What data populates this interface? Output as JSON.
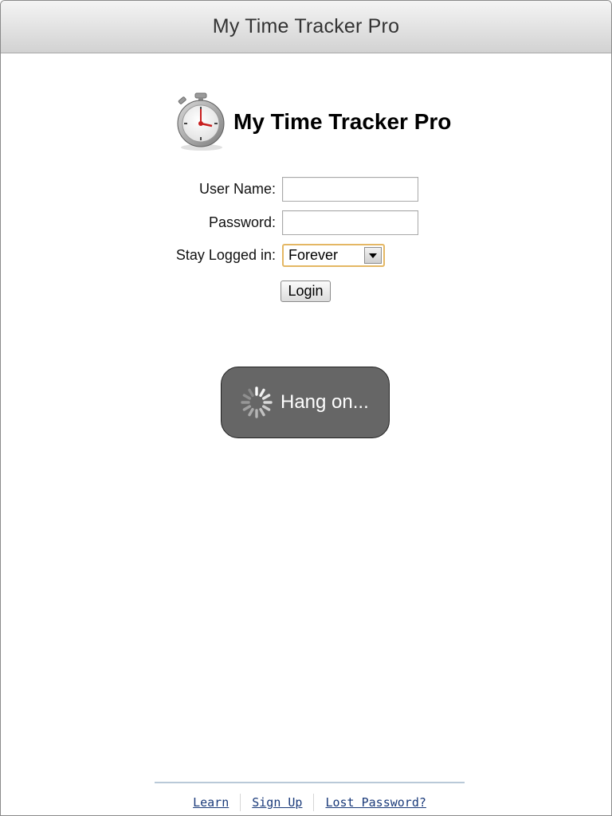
{
  "titlebar": {
    "title": "My Time Tracker Pro"
  },
  "logo": {
    "icon": "stopwatch-icon",
    "text": "My Time Tracker Pro"
  },
  "form": {
    "username_label": "User Name:",
    "username_value": "",
    "password_label": "Password:",
    "password_value": "",
    "stay_label": "Stay Logged in:",
    "stay_selected": "Forever",
    "login_label": "Login"
  },
  "hud": {
    "icon": "loading-spinner-icon",
    "message": "Hang on..."
  },
  "footer": {
    "links": [
      {
        "label": "Learn"
      },
      {
        "label": "Sign Up"
      },
      {
        "label": "Lost Password?"
      }
    ]
  },
  "colors": {
    "hud_background": "#666666",
    "select_focus_border": "#e4b764",
    "link": "#1a3a7a",
    "footer_rule": "#b9c9d8"
  }
}
